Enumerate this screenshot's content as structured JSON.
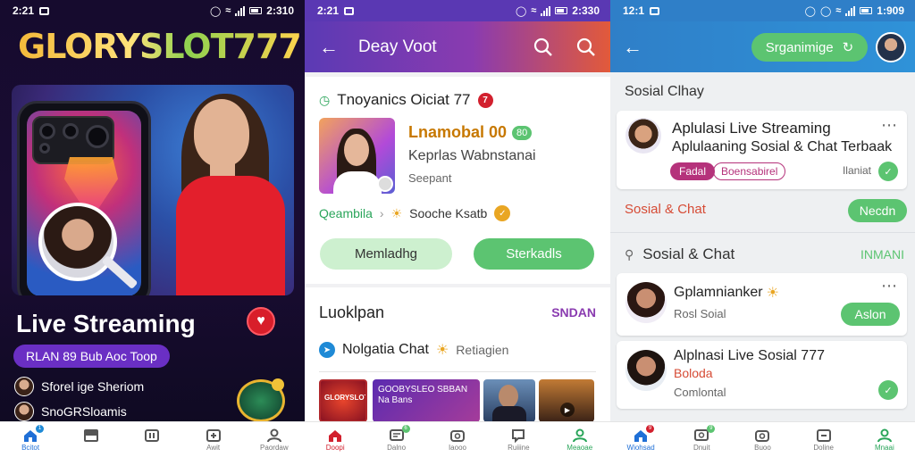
{
  "panel1": {
    "status": {
      "time": "2:21",
      "clock": "2:310"
    },
    "logo": "GLORYSLOT777",
    "live_title": "Live Streaming",
    "promo_pill": "RLAN 89 Bub Aoc Toop",
    "rows": [
      "Sforel ige Sheriom",
      "SnoGRSloamis"
    ],
    "nav": [
      {
        "icon": "home-icon",
        "label": "Bcitot",
        "badge": "1"
      },
      {
        "icon": "book-icon",
        "label": ""
      },
      {
        "icon": "pause-icon",
        "label": ""
      },
      {
        "icon": "plus-box-icon",
        "label": "Awit"
      },
      {
        "icon": "profile-icon",
        "label": "Paordaw"
      }
    ],
    "colors": {
      "accent": "#6a2fc4",
      "live": "#d81e2a"
    }
  },
  "panel2": {
    "status": {
      "time": "2:21",
      "clock": "2:330"
    },
    "header_title": "Deay Voot",
    "section_title": "Tnoyanics Oiciat 77",
    "section_badge": "7",
    "profile_name": "Lnamobal 00",
    "profile_badge": "80",
    "profile_sub": "Keprlas Wabnstanai",
    "profile_meta": "Seepant",
    "crumb_left": "Qeambila",
    "crumb_right": "Sooche Ksatb",
    "button_secondary": "Memladhg",
    "button_primary": "Sterkadls",
    "list_title": "Luoklpan",
    "list_action": "SNDAN",
    "chat_title": "Nolgatia Chat",
    "chat_tag": "Retiagien",
    "thumbs": [
      "GLORYSLOT",
      "GOOBYSLEO SBBAN Na Bans"
    ],
    "nav": [
      {
        "icon": "home-icon",
        "label": "Doopi"
      },
      {
        "icon": "message-icon",
        "label": "Dalno",
        "badge": "6"
      },
      {
        "icon": "camera-icon",
        "label": "Iaooo"
      },
      {
        "icon": "chat-icon",
        "label": "Ruiiine"
      },
      {
        "icon": "profile-icon",
        "label": "Meaoae"
      }
    ],
    "colors": {
      "accent": "#8a3bb0",
      "green": "#5cc471"
    }
  },
  "panel3": {
    "status": {
      "time": "12:1",
      "clock": "1:909"
    },
    "search_label": "Srganimige",
    "social_title": "Sosial Clhay",
    "card1_title": "Aplulasi Live Streaming",
    "card1_sub": "Aplulaaning Sosial & Chat Terbaak",
    "card1_tag1": "Fadal",
    "card1_tag2": "Boensabirel",
    "card1_meta": "Ilaniat",
    "section_red": "Sosial & Chat",
    "section_red_btn": "Necdn",
    "section2_title": "Sosial & Chat",
    "section2_action": "INMANI",
    "card2_title": "Gplamnianker",
    "card2_sub": "Rosl Soial",
    "card2_btn": "Aslon",
    "card3_title": "Alplnasi Live Sosial 777",
    "card3_tag": "Boloda",
    "card3_sub": "Comlontal",
    "nav": [
      {
        "icon": "home-icon",
        "label": "Wiohsad",
        "badge": "9"
      },
      {
        "icon": "message-icon",
        "label": "Dnuit",
        "badge": "9"
      },
      {
        "icon": "camera-icon",
        "label": "Buoo"
      },
      {
        "icon": "minus-box-icon",
        "label": "Doline"
      },
      {
        "icon": "profile-icon",
        "label": "Mnaai"
      }
    ],
    "colors": {
      "accent": "#2f7fc8",
      "green": "#5cc471",
      "red": "#d64b35"
    }
  }
}
